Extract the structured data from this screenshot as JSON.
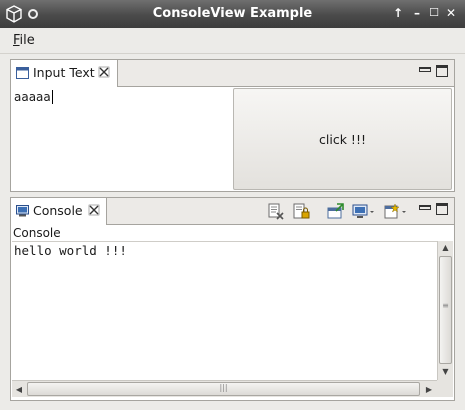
{
  "window": {
    "title": "ConsoleView Example"
  },
  "menu": {
    "file": "File"
  },
  "input_view": {
    "tab_label": "Input Text",
    "text_value": "aaaaa",
    "button_label": "click !!!"
  },
  "console_view": {
    "tab_label": "Console",
    "header_label": "Console",
    "output": "hello world !!!"
  }
}
